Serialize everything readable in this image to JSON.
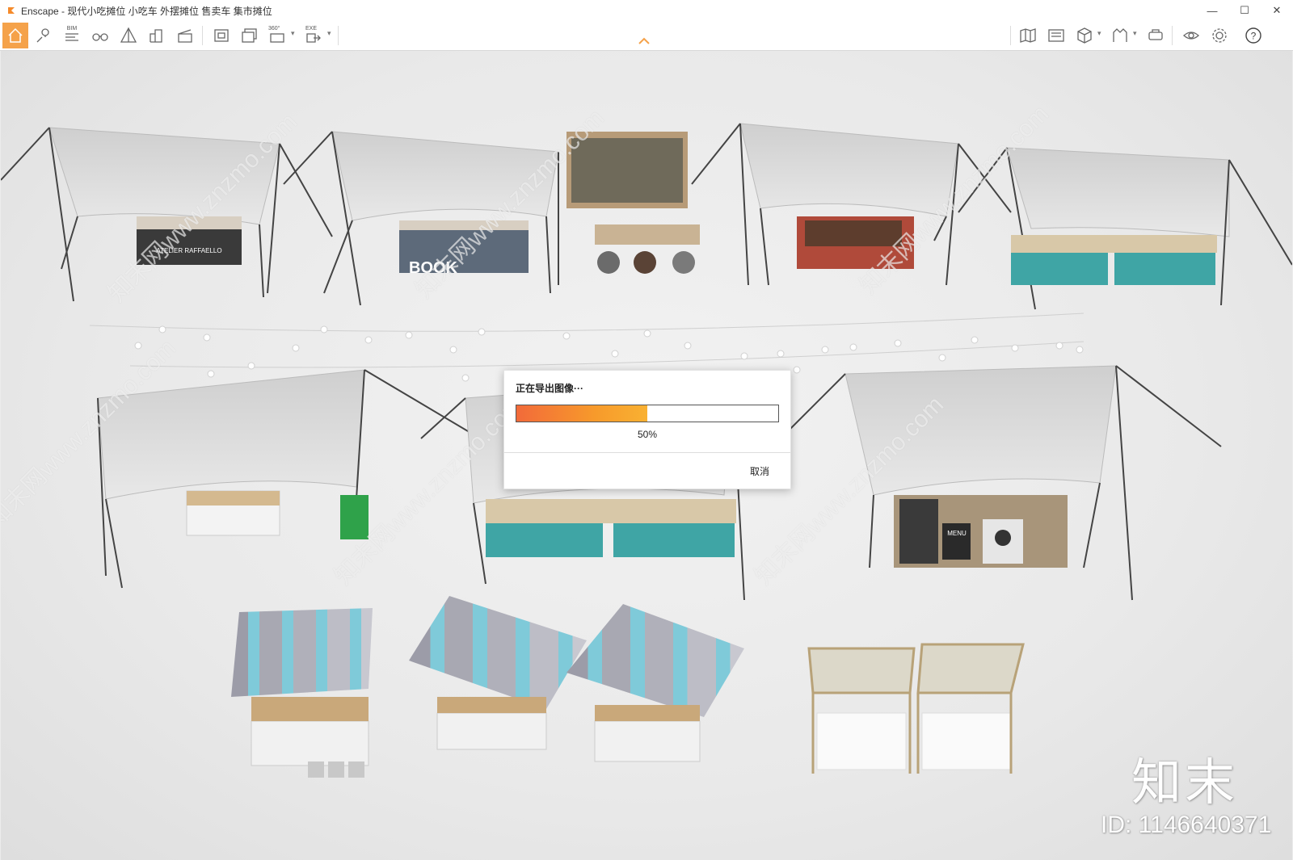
{
  "window": {
    "title": "Enscape - 现代小吃摊位 小吃车 外摆摊位 售卖车 集市摊位",
    "controls": [
      "minimize-icon",
      "maximize-icon",
      "close-icon"
    ]
  },
  "toolbar": {
    "bim_label": "BIM",
    "pano_label": "360°",
    "exe_label": "EXE",
    "left_icons": [
      "home-icon",
      "location-pin-icon",
      "bim-list-icon",
      "binoculars-icon",
      "perspective-icon",
      "buildings-icon",
      "clapperboard-icon",
      "screenshot-icon",
      "batch-render-icon",
      "panorama-icon",
      "export-exe-icon"
    ],
    "right_icons": [
      "map-icon",
      "asset-library-icon",
      "cube-view-icon",
      "material-icon",
      "vr-headset-icon",
      "visual-settings-icon",
      "gear-icon",
      "help-icon"
    ]
  },
  "dialog": {
    "title": "正在导出图像···",
    "progress": 0.5,
    "percent_text": "50%",
    "cancel_label": "取消"
  },
  "scene": {
    "book_sign": "BOOK",
    "stall_sign": "ATELIER RAFFAELLO",
    "menu_sign": "MENU"
  },
  "watermark": {
    "logo_text": "知末",
    "id_text": "ID: 1146640371",
    "diagonal_text": "知末网www.znzmo.com"
  },
  "colors": {
    "accent": "#f5a24a",
    "progress_start": "#f26a3a",
    "progress_end": "#f9b132",
    "teal": "#3fa5a5",
    "canopy": "#dcdcdc"
  }
}
